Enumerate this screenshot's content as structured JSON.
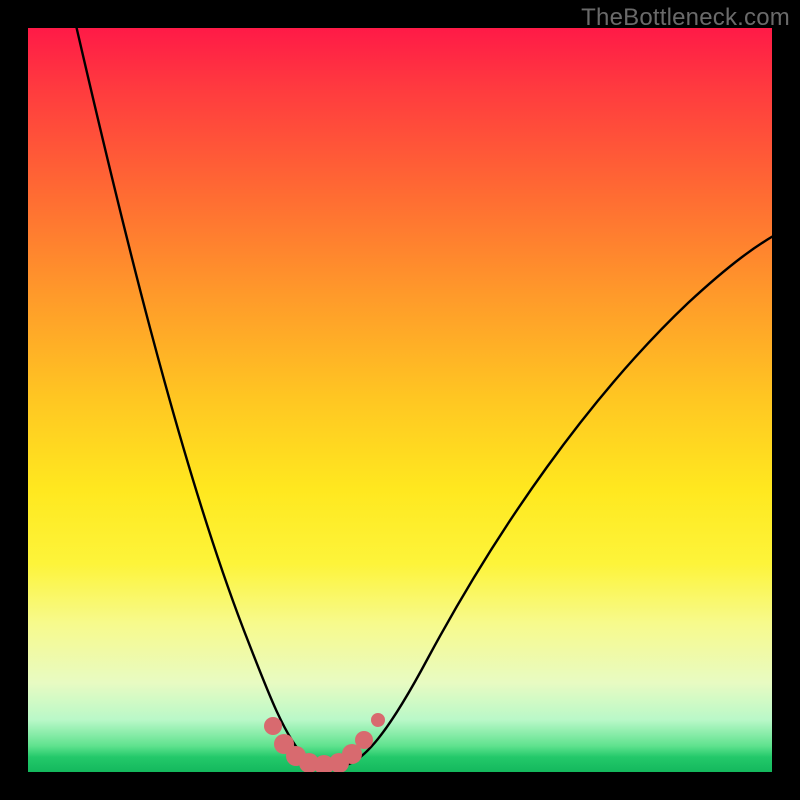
{
  "watermark": "TheBottleneck.com",
  "chart_data": {
    "type": "line",
    "title": "",
    "xlabel": "",
    "ylabel": "",
    "xlim": [
      0,
      1
    ],
    "ylim": [
      0,
      1
    ],
    "series": [
      {
        "name": "bottleneck-curve",
        "x": [
          0.0,
          0.05,
          0.1,
          0.15,
          0.2,
          0.25,
          0.3,
          0.33,
          0.36,
          0.38,
          0.4,
          0.42,
          0.44,
          0.47,
          0.52,
          0.58,
          0.66,
          0.74,
          0.82,
          0.9,
          1.0
        ],
        "y": [
          1.0,
          0.87,
          0.73,
          0.59,
          0.45,
          0.31,
          0.17,
          0.08,
          0.03,
          0.01,
          0.01,
          0.01,
          0.03,
          0.08,
          0.16,
          0.25,
          0.36,
          0.46,
          0.55,
          0.63,
          0.72
        ]
      }
    ],
    "markers": {
      "name": "highlight-dots",
      "color": "#d86a6f",
      "points": [
        {
          "x": 0.328,
          "y": 0.06
        },
        {
          "x": 0.345,
          "y": 0.035
        },
        {
          "x": 0.36,
          "y": 0.018
        },
        {
          "x": 0.378,
          "y": 0.01
        },
        {
          "x": 0.398,
          "y": 0.008
        },
        {
          "x": 0.418,
          "y": 0.01
        },
        {
          "x": 0.436,
          "y": 0.02
        },
        {
          "x": 0.452,
          "y": 0.038
        },
        {
          "x": 0.47,
          "y": 0.066
        }
      ]
    },
    "gradient_stops": [
      {
        "pos": 0.0,
        "color": "#ff1a47"
      },
      {
        "pos": 0.5,
        "color": "#ffe81f"
      },
      {
        "pos": 1.0,
        "color": "#14b85d"
      }
    ]
  }
}
